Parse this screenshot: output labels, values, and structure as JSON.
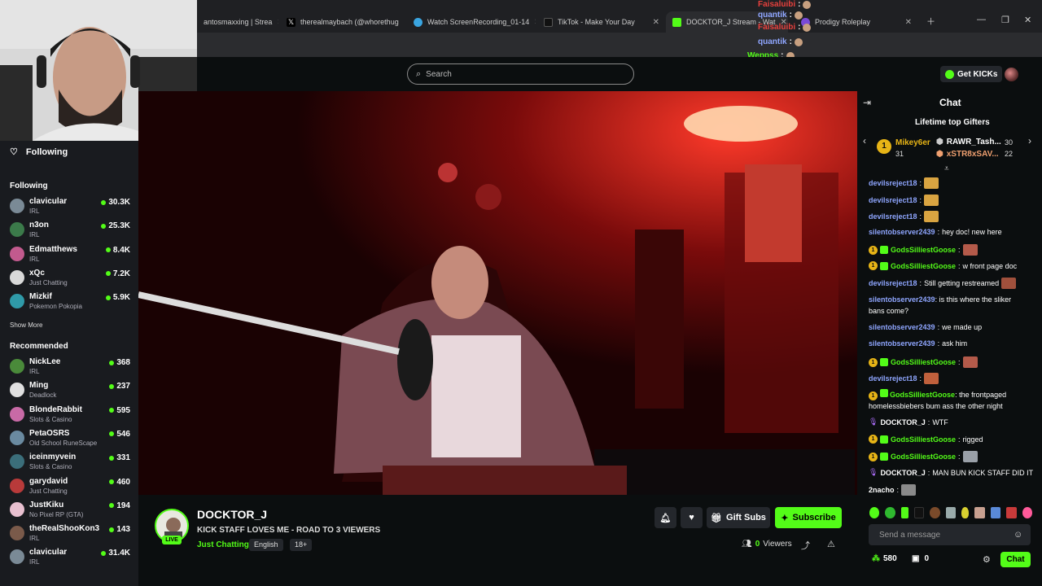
{
  "browser": {
    "tabs": [
      {
        "label": "antosmaxxing | Strea",
        "active": false
      },
      {
        "label": "therealmaybach (@whorethug",
        "active": false
      },
      {
        "label": "Watch ScreenRecording_01-14",
        "active": false
      },
      {
        "label": "TikTok - Make Your Day",
        "active": false
      },
      {
        "label": "DOCKTOR_J Stream - Wat",
        "active": true
      },
      {
        "label": "Prodigy Roleplay",
        "active": false
      }
    ]
  },
  "overlay_chat": [
    {
      "user": "Faisaluibi",
      "color": "#e8413d"
    },
    {
      "user": "quantik",
      "color": "#8fa6ff"
    },
    {
      "user": "Faisaluibi",
      "color": "#e8413d"
    },
    {
      "user": "quantik",
      "color": "#8fa6ff"
    },
    {
      "user": "Weppss",
      "color": "#53fc18"
    },
    {
      "user": "Faisaluibi",
      "color": "#e8413d"
    }
  ],
  "header": {
    "search_placeholder": "Search",
    "get_kicks": "Get KICKs"
  },
  "sidebar": {
    "following_title": "Following",
    "following_heading": "Following",
    "following": [
      {
        "name": "clavicular",
        "category": "IRL",
        "viewers": "30.3K",
        "color": "#7a8a96"
      },
      {
        "name": "n3on",
        "category": "IRL",
        "viewers": "25.3K",
        "color": "#3b7a4a"
      },
      {
        "name": "Edmatthews",
        "category": "IRL",
        "viewers": "8.4K",
        "color": "#c25a8e"
      },
      {
        "name": "xQc",
        "category": "Just Chatting",
        "viewers": "7.2K",
        "color": "#d9d9d9"
      },
      {
        "name": "Mizkif",
        "category": "Pokemon Pokopia",
        "viewers": "5.9K",
        "color": "#2f9aa8"
      }
    ],
    "show_more": "Show More",
    "recommended_heading": "Recommended",
    "recommended": [
      {
        "name": "NickLee",
        "category": "IRL",
        "viewers": "368",
        "color": "#4a8a3a"
      },
      {
        "name": "Ming",
        "category": "Deadlock",
        "viewers": "237",
        "color": "#e0e0e0"
      },
      {
        "name": "BlondeRabbit",
        "category": "Slots & Casino",
        "viewers": "595",
        "color": "#c86aa6"
      },
      {
        "name": "PetaOSRS",
        "category": "Old School RuneScape",
        "viewers": "546",
        "color": "#6a8aa0"
      },
      {
        "name": "iceinmyvein",
        "category": "Slots & Casino",
        "viewers": "331",
        "color": "#3b6e7a"
      },
      {
        "name": "garydavid",
        "category": "Just Chatting",
        "viewers": "460",
        "color": "#b83a3a"
      },
      {
        "name": "JustKiku",
        "category": "No Pixel RP (GTA)",
        "viewers": "194",
        "color": "#e8c0d0"
      },
      {
        "name": "theRealShooKon3",
        "category": "IRL",
        "viewers": "143",
        "color": "#7a5a4a"
      },
      {
        "name": "clavicular",
        "category": "IRL",
        "viewers": "31.4K",
        "color": "#7a8a96"
      }
    ]
  },
  "stream": {
    "channel": "DOCKTOR_J",
    "title": "KICK STAFF LOVES ME - ROAD TO 3 VIEWERS",
    "category": "Just Chatting",
    "tags": [
      "English",
      "18+"
    ],
    "live_label": "LIVE",
    "gift_subs": "Gift Subs",
    "subscribe": "Subscribe",
    "viewers_count": "0",
    "viewers_label": "Viewers"
  },
  "chat": {
    "title": "Chat",
    "gifters_title": "Lifetime top Gifters",
    "gifters": [
      {
        "rank": "1",
        "name": "Mikey6er",
        "count": "31"
      },
      {
        "rank": "2",
        "name": "RAWR_Tash...",
        "count": "30"
      },
      {
        "rank": "3",
        "name": "xSTR8xSAV...",
        "count": "22"
      }
    ],
    "messages": [
      {
        "user": "devilsreject18",
        "text": "",
        "color": "#8fa6ff",
        "badges": false,
        "emote": "#d9a441"
      },
      {
        "user": "devilsreject18",
        "text": "",
        "color": "#8fa6ff",
        "badges": false,
        "emote": "#d9a441"
      },
      {
        "user": "devilsreject18",
        "text": "",
        "color": "#8fa6ff",
        "badges": false,
        "emote": "#d9a441"
      },
      {
        "user": "silentobserver2439",
        "text": "hey doc! new here",
        "color": "#8fa6ff",
        "badges": false,
        "emote": ""
      },
      {
        "user": "GodsSilliestGoose",
        "text": "",
        "color": "#53fc18",
        "badges": true,
        "emote": "#b45a4a"
      },
      {
        "user": "GodsSilliestGoose",
        "text": "w front page doc",
        "color": "#53fc18",
        "badges": true,
        "emote": ""
      },
      {
        "user": "devilsreject18",
        "text": "Still getting restreamed",
        "color": "#8fa6ff",
        "badges": false,
        "emote": "#a0503c"
      },
      {
        "user": "silentobserver2439",
        "text": "is this where the sliker bans come?",
        "color": "#8fa6ff",
        "badges": false,
        "emote": ""
      },
      {
        "user": "silentobserver2439",
        "text": "we made up",
        "color": "#8fa6ff",
        "badges": false,
        "emote": ""
      },
      {
        "user": "silentobserver2439",
        "text": "ask him",
        "color": "#8fa6ff",
        "badges": false,
        "emote": ""
      },
      {
        "user": "GodsSilliestGoose",
        "text": "",
        "color": "#53fc18",
        "badges": true,
        "emote": "#b45a4a"
      },
      {
        "user": "devilsreject18",
        "text": "",
        "color": "#8fa6ff",
        "badges": false,
        "emote": "#c0603c"
      },
      {
        "user": "GodsSilliestGoose",
        "text": "the frontpaged homelessbiebers bum ass the other night",
        "color": "#53fc18",
        "badges": true,
        "emote": ""
      },
      {
        "user": "DOCKTOR_J",
        "text": "WTF",
        "color": "#ffffff",
        "badges": false,
        "emote": ""
      },
      {
        "user": "GodsSilliestGoose",
        "text": "rigged",
        "color": "#53fc18",
        "badges": true,
        "emote": ""
      },
      {
        "user": "GodsSilliestGoose",
        "text": "",
        "color": "#53fc18",
        "badges": true,
        "emote": "#9aa0a8"
      },
      {
        "user": "DOCKTOR_J",
        "text": "MAN BUN KICK STAFF DID IT",
        "color": "#ffffff",
        "badges": false,
        "emote": ""
      },
      {
        "user": "2nacho",
        "text": "",
        "color": "#ffffff",
        "badges": false,
        "emote": "#8a8a8a"
      }
    ],
    "input_placeholder": "Send a message",
    "points": "580",
    "chest_count": "0",
    "send_label": "Chat"
  }
}
